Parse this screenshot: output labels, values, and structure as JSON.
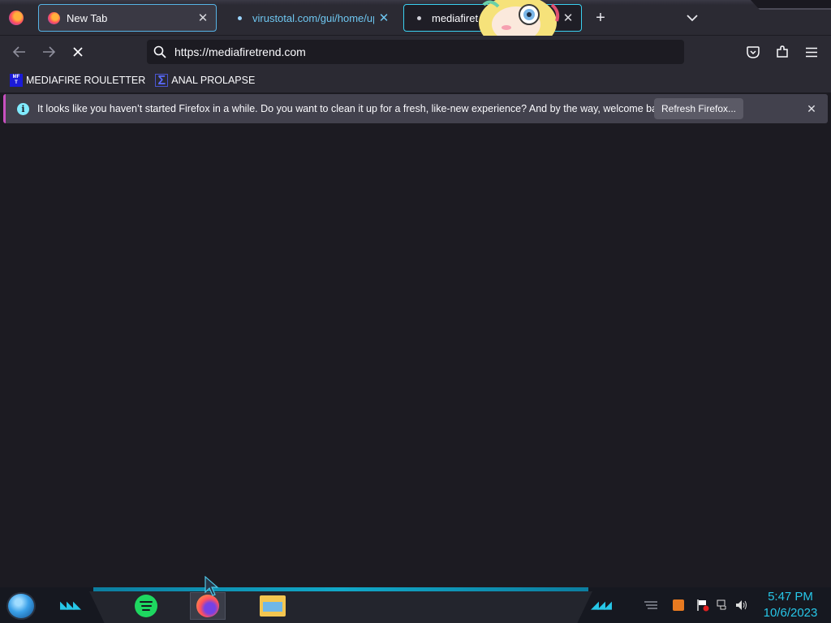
{
  "tabs": [
    {
      "title": "New Tab",
      "state": "selected"
    },
    {
      "title": "virustotal.com/gui/home/uplo",
      "state": "loading"
    },
    {
      "title": "mediafiret",
      "state": "loading"
    }
  ],
  "toolbar": {
    "url": "https://mediafiretrend.com"
  },
  "bookmarks": [
    {
      "label": "MEDIAFIRE ROULETTER",
      "icon": "mft-icon"
    },
    {
      "label": "ANAL PROLAPSE",
      "icon": "sigma-icon"
    }
  ],
  "notification": {
    "message": "It looks like you haven’t started Firefox in a while. Do you want to clean it up for a fresh, like-new experience? And by the way, welcome back!",
    "button_label": "Refresh Firefox..."
  },
  "taskbar": {
    "apps": [
      "spotify-icon",
      "firefox-icon",
      "file-explorer-icon"
    ],
    "time": "5:47 PM",
    "date": "10/6/2023"
  },
  "colors": {
    "accent": "#27c7e8",
    "chrome_bg": "#2b2a33",
    "content_bg": "#1c1b22",
    "notification_bg": "#42414d"
  }
}
